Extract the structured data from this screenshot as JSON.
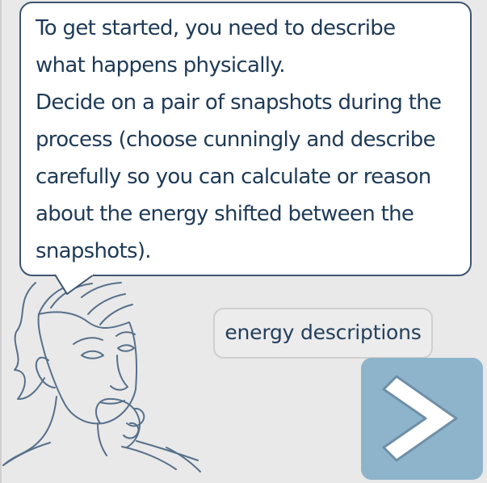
{
  "speech": {
    "text": "To get started, you need to describe\nwhat happens physically.\nDecide on a pair of snapshots during the\nprocess (choose cunningly and describe\ncarefully so you can calculate or reason\nabout the energy shifted between the\nsnapshots)."
  },
  "buttons": {
    "energy_descriptions_label": "energy descriptions",
    "next_icon": "chevron-right-icon"
  },
  "illustration": {
    "figure": "thinking-person"
  },
  "colors": {
    "background": "#e9e9e9",
    "bubble_border": "#3d5571",
    "text": "#1e3a57",
    "figure_line": "#56708a",
    "next_button": "#8eb4cc",
    "next_arrow": "#ffffff"
  }
}
